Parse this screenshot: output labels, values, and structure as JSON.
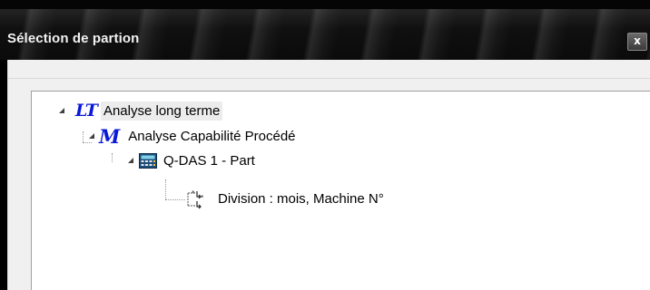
{
  "window": {
    "title": "Sélection de partion",
    "close_label": "x"
  },
  "tree": {
    "nodes": [
      {
        "level": 0,
        "icon": "lt-analysis-icon",
        "icon_text": "LT",
        "label": "Analyse long terme",
        "expanded": true,
        "selected": true
      },
      {
        "level": 1,
        "icon": "m-capability-icon",
        "icon_text": "M",
        "label": "Analyse Capabilité Procédé",
        "expanded": true,
        "selected": false
      },
      {
        "level": 2,
        "icon": "calculator-icon",
        "label": "Q-DAS 1 - Part",
        "expanded": true,
        "selected": false
      },
      {
        "level": 3,
        "icon": "split-division-icon",
        "label": "Division : mois, Machine N°",
        "expanded": false,
        "selected": false
      }
    ]
  },
  "colors": {
    "titlebar": "#111111",
    "client_background": "#f0f0f0",
    "tree_background": "#ffffff",
    "icon_blue": "#0a18d8",
    "selection": "#ececec"
  }
}
